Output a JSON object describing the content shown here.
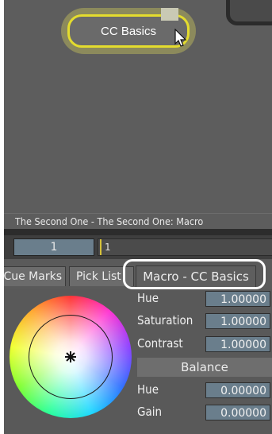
{
  "node_panel": {
    "macro_node_label": "CC Basics",
    "footer_text": "The Second One - The Second One: Macro"
  },
  "timeline": {
    "frame_value": "1",
    "track_frame_label": "1"
  },
  "tabs": [
    {
      "label": "Cue Marks"
    },
    {
      "label": "Pick List"
    },
    {
      "label": "Macro - CC Basics"
    }
  ],
  "controls": {
    "hue": {
      "label": "Hue",
      "value": "1.00000"
    },
    "saturation": {
      "label": "Saturation",
      "value": "1.00000"
    },
    "contrast": {
      "label": "Contrast",
      "value": "1.00000"
    },
    "balance_header": "Balance",
    "balance_hue": {
      "label": "Hue",
      "value": "0.00000"
    },
    "balance_gain": {
      "label": "Gain",
      "value": "0.00000"
    }
  },
  "colors": {
    "node_outline": "#e4dc2e",
    "value_field": "#6a7e8c",
    "highlight_ring": "#ffffff"
  }
}
